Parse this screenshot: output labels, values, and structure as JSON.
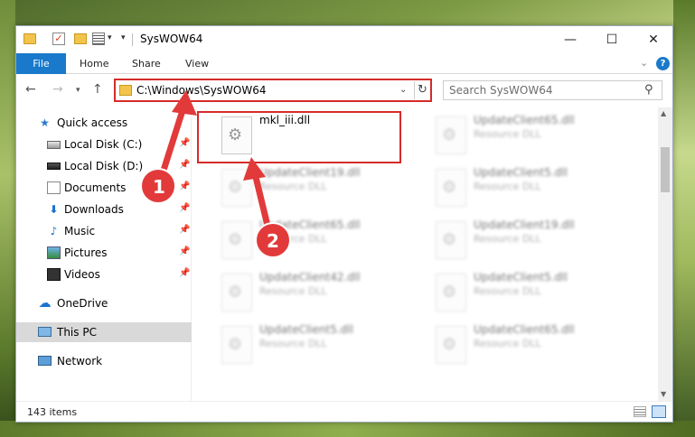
{
  "window": {
    "title": "SysWOW64",
    "min_glyph": "—",
    "max_glyph": "☐",
    "close_glyph": "✕"
  },
  "ribbon": {
    "tabs": [
      "File",
      "Home",
      "Share",
      "View"
    ],
    "help_glyph": "?"
  },
  "nav": {
    "address": "C:\\Windows\\SysWOW64",
    "search_placeholder": "Search SysWOW64"
  },
  "sidebar": {
    "items": [
      {
        "label": "Quick access",
        "icon": "star-icon"
      },
      {
        "label": "Local Disk (C:)",
        "icon": "drive-icon"
      },
      {
        "label": "Local Disk (D:)",
        "icon": "drive-icon"
      },
      {
        "label": "Documents",
        "icon": "documents-icon"
      },
      {
        "label": "Downloads",
        "icon": "download-icon"
      },
      {
        "label": "Music",
        "icon": "music-icon"
      },
      {
        "label": "Pictures",
        "icon": "pictures-icon"
      },
      {
        "label": "Videos",
        "icon": "videos-icon"
      },
      {
        "label": "OneDrive",
        "icon": "cloud-icon"
      },
      {
        "label": "This PC",
        "icon": "computer-icon"
      },
      {
        "label": "Network",
        "icon": "network-icon"
      }
    ],
    "selected": "This PC"
  },
  "files": [
    {
      "name": "mkl_iii.dll",
      "type": ""
    },
    {
      "name": "UpdateClient65.dll",
      "type": "Resource DLL"
    },
    {
      "name": "UpdateClient19.dll",
      "type": "Resource DLL"
    },
    {
      "name": "UpdateClient5.dll",
      "type": "Resource DLL"
    },
    {
      "name": "UpdateClient65.dll",
      "type": "Resource DLL"
    },
    {
      "name": "UpdateClient19.dll",
      "type": "Resource DLL"
    },
    {
      "name": "UpdateClient42.dll",
      "type": "Resource DLL"
    },
    {
      "name": "UpdateClient5.dll",
      "type": "Resource DLL"
    },
    {
      "name": "UpdateClient5.dll",
      "type": "Resource DLL"
    },
    {
      "name": "UpdateClient65.dll",
      "type": "Resource DLL"
    }
  ],
  "annotations": {
    "badge_1": "1",
    "badge_2": "2",
    "highlight_color": "#d62a2a"
  },
  "status": {
    "item_count": "143 items"
  },
  "colors": {
    "accent": "#1979ca",
    "selection": "#d9d9d9"
  }
}
